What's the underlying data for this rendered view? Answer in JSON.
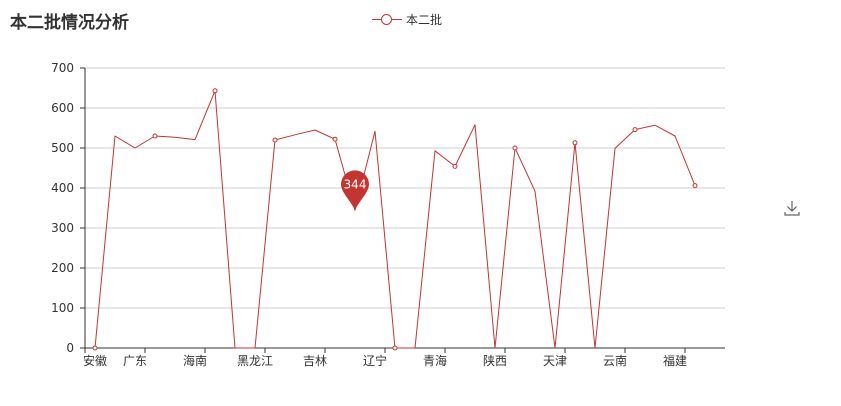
{
  "title": "本二批情况分析",
  "legend": {
    "label": "本二批"
  },
  "colors": {
    "series": "#c23531",
    "axis": "#333333",
    "grid": "#cccccc"
  },
  "icons": {
    "download": "download-icon"
  },
  "chart_data": {
    "type": "line",
    "title": "本二批情况分析",
    "x": [
      "安徽",
      "",
      "广东",
      "",
      "",
      "海南",
      "",
      "",
      "黑龙江",
      "",
      "",
      "吉林",
      "",
      "",
      "辽宁",
      "",
      "",
      "青海",
      "",
      "",
      "陕西",
      "",
      "",
      "天津",
      "",
      "",
      "云南",
      "",
      "",
      "福建",
      ""
    ],
    "tick_labels": [
      "安徽",
      "广东",
      "海南",
      "黑龙江",
      "吉林",
      "辽宁",
      "青海",
      "陕西",
      "天津",
      "云南",
      "福建"
    ],
    "series": [
      {
        "name": "本二批",
        "values": [
          0,
          530,
          500,
          530,
          527,
          521,
          643,
          0,
          0,
          520,
          533,
          545,
          522,
          344,
          542,
          0,
          0,
          493,
          454,
          558,
          0,
          500,
          392,
          0,
          513,
          0,
          499,
          546,
          557,
          530,
          406
        ],
        "markers": [
          0,
          3,
          6,
          9,
          12,
          15,
          18,
          21,
          24,
          27,
          30
        ]
      }
    ],
    "ylim": [
      0,
      700
    ],
    "yticks": [
      0,
      100,
      200,
      300,
      400,
      500,
      600,
      700
    ],
    "grid": true,
    "legend_position": "top-center",
    "mark_point": {
      "index": 13,
      "label": "344"
    }
  }
}
